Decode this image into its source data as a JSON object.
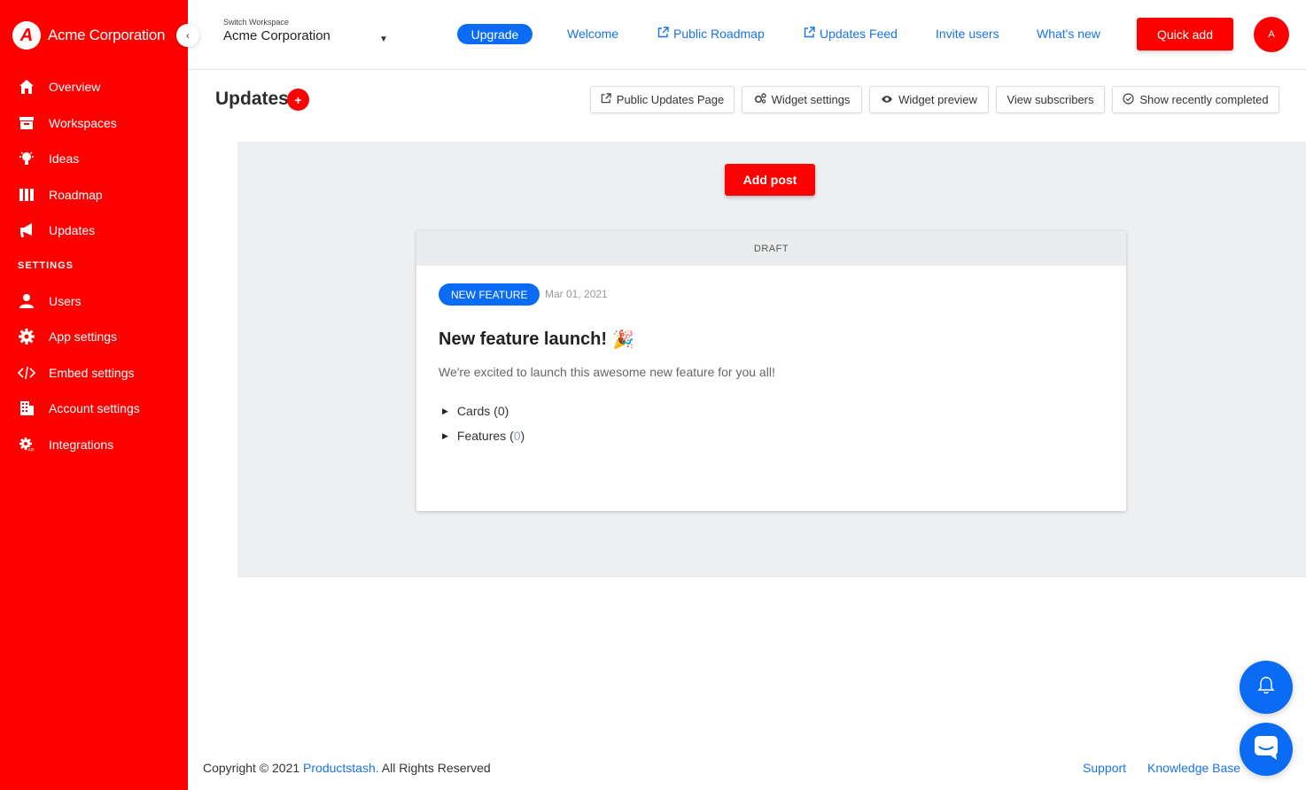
{
  "brand": {
    "logo_letter": "A",
    "name": "Acme Corporation"
  },
  "sidebar": {
    "items": [
      {
        "label": "Overview",
        "icon": "home-icon"
      },
      {
        "label": "Workspaces",
        "icon": "archive-icon"
      },
      {
        "label": "Ideas",
        "icon": "lightbulb-icon"
      },
      {
        "label": "Roadmap",
        "icon": "columns-icon"
      },
      {
        "label": "Updates",
        "icon": "megaphone-icon"
      }
    ],
    "settings_heading": "SETTINGS",
    "settings_items": [
      {
        "label": "Users",
        "icon": "user-icon"
      },
      {
        "label": "App settings",
        "icon": "gear-icon"
      },
      {
        "label": "Embed settings",
        "icon": "code-icon"
      },
      {
        "label": "Account settings",
        "icon": "building-icon"
      },
      {
        "label": "Integrations",
        "icon": "api-gear-icon"
      }
    ]
  },
  "topbar": {
    "workspace_label": "Switch Workspace",
    "workspace_name": "Acme Corporation",
    "upgrade": "Upgrade",
    "links": {
      "welcome": "Welcome",
      "public_roadmap": "Public Roadmap",
      "updates_feed": "Updates Feed",
      "invite_users": "Invite users",
      "whats_new": "What's new"
    },
    "quick_add": "Quick add",
    "avatar_initial": "A"
  },
  "page": {
    "title": "Updates",
    "title_plus": "+",
    "toolbar": {
      "public_updates_page": "Public Updates Page",
      "widget_settings": "Widget settings",
      "widget_preview": "Widget preview",
      "view_subscribers": "View subscribers",
      "show_recently_completed": "Show recently completed"
    },
    "add_post": "Add post",
    "post": {
      "status": "DRAFT",
      "badge": "NEW FEATURE",
      "date": "Mar 01, 2021",
      "title": "New feature launch!",
      "emoji": "🎉",
      "body": "We're excited to launch this awesome new feature for you all!",
      "cards_label": "Cards",
      "cards_count": "(0)",
      "features_label": "Features",
      "features_count_open": "(",
      "features_count": "0",
      "features_count_close": ")"
    }
  },
  "footer": {
    "copyright_prefix": "Copyright © 2021",
    "company": "Productstash.",
    "rights": "All Rights Reserved",
    "support": "Support",
    "knowledge_base": "Knowledge Base"
  },
  "colors": {
    "brand_red": "#ff0000",
    "accent_blue": "#0a6cf5",
    "link_blue": "#1a73e8"
  }
}
